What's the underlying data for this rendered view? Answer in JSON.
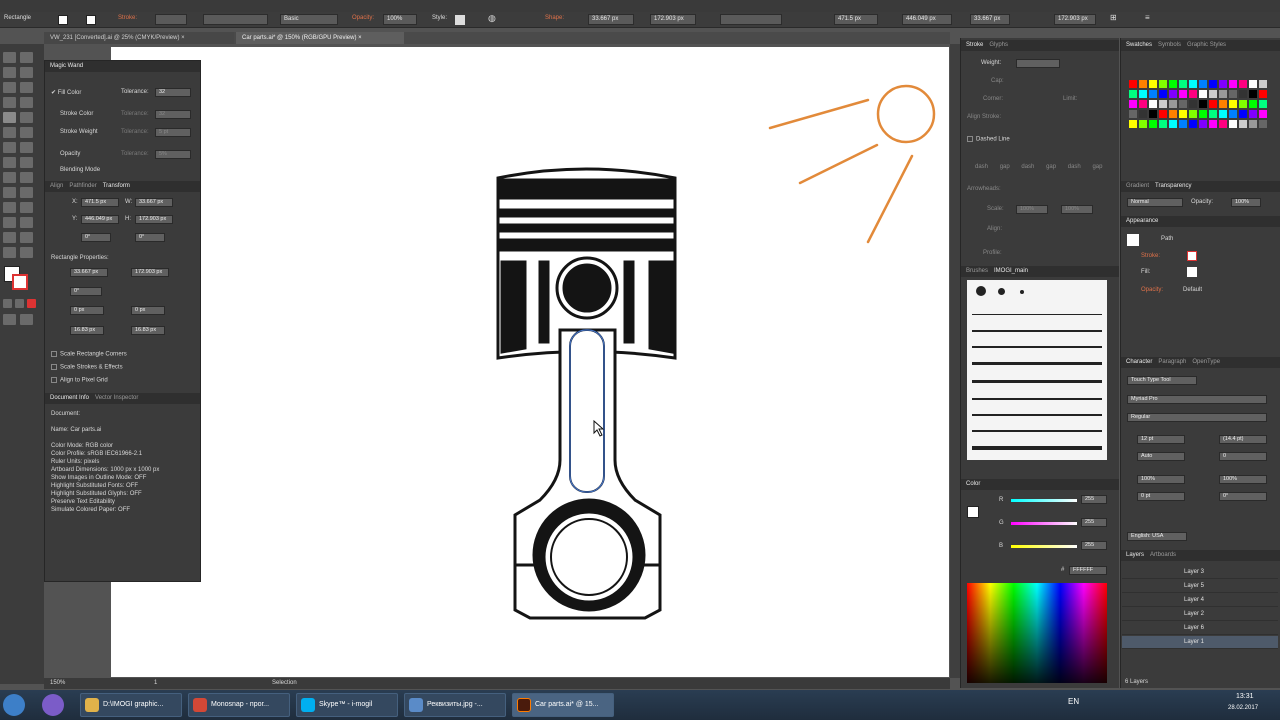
{
  "control_bar": {
    "tool_name": "Rectangle",
    "stroke_label": "Stroke:",
    "brush_style": "Basic",
    "opacity_label": "Opacity:",
    "opacity_value": "100%",
    "style_label": "Style:",
    "shape_label": "Shape:",
    "w_value": "33.667 px",
    "h_value": "172.903 px",
    "x_value": "471.5 px",
    "y_value": "446.049 px",
    "w2_value": "33.667 px",
    "h2_value": "172.903 px"
  },
  "tabs": [
    {
      "label": "VW_231 [Converted].ai @ 25% (CMYK/Preview)",
      "close": "×"
    },
    {
      "label": "Car parts.ai* @ 150% (RGB/GPU Preview)",
      "close": "×"
    }
  ],
  "magic_wand": {
    "title": "Magic Wand",
    "fill_color": "Fill Color",
    "tolerance_label": "Tolerance:",
    "tolerance_value": "32",
    "stroke_color": "Stroke Color",
    "stroke_weight": "Stroke Weight",
    "opacity": "Opacity",
    "blending_mode": "Blending Mode",
    "dim_tol_1": "32",
    "dim_tol_2": "5 pt",
    "dim_tol_3": "5%"
  },
  "transform": {
    "tabs": [
      "Align",
      "Pathfinder",
      "Transform"
    ],
    "x_label": "X:",
    "x": "471.5 px",
    "y_label": "Y:",
    "y": "446.049 px",
    "w_label": "W:",
    "w": "33.667 px",
    "h_label": "H:",
    "h": "172.903 px",
    "rot": "0°",
    "shear": "0°",
    "rect_props": "Rectangle Properties:",
    "rw": "33.667 px",
    "rh": "172.903 px",
    "angle": "0°",
    "r1": "0 px",
    "r2": "0 px",
    "r3": "16.83 px",
    "r4": "16.83 px",
    "scale_corners": "Scale Rectangle Corners",
    "scale_strokes": "Scale Strokes & Effects",
    "align_pixel": "Align to Pixel Grid"
  },
  "doc_info": {
    "tabs": [
      "Document Info",
      "Vector Inspector"
    ],
    "document": "Document:",
    "lines": [
      "Name: Car parts.ai",
      "Color Mode: RGB color",
      "Color Profile: sRGB IEC61966-2.1",
      "Ruler Units: pixels",
      "Artboard Dimensions: 1000 px x 1000 px",
      "Show Images in Outline Mode: OFF",
      "Highlight Substituted Fonts: OFF",
      "Highlight Substituted Glyphs: OFF",
      "Preserve Text Editability",
      "Simulate Colored Paper: OFF"
    ]
  },
  "stroke_panel": {
    "tabs": [
      "Stroke",
      "Glyphs"
    ],
    "weight_label": "Weight:",
    "cap_label": "Cap:",
    "corner_label": "Corner:",
    "limit_label": "Limit:",
    "align_label": "Align Stroke:",
    "dashed_line": "Dashed Line",
    "dash_labels": [
      "dash",
      "gap",
      "dash",
      "gap",
      "dash",
      "gap"
    ],
    "arrowheads": "Arrowheads:",
    "scale": "Scale:",
    "scale_value": "100%",
    "align": "Align:",
    "profile": "Profile:"
  },
  "brushes": {
    "tabs": [
      "Brushes",
      "IMOGI_main"
    ]
  },
  "color_panel": {
    "title": "Color",
    "r": "R",
    "g": "G",
    "b": "B",
    "r_val": "255",
    "g_val": "255",
    "b_val": "255",
    "hex_label": "#",
    "hex": "FFFFFF"
  },
  "swatches": {
    "tabs": [
      "Swatches",
      "Symbols",
      "Graphic Styles"
    ]
  },
  "gradient": {
    "tabs": [
      "Gradient",
      "Transparency"
    ],
    "mode": "Normal",
    "opacity_label": "Opacity:",
    "opacity": "100%"
  },
  "appearance": {
    "title": "Appearance",
    "path": "Path",
    "stroke": "Stroke:",
    "fill": "Fill:",
    "opacity": "Opacity:",
    "opacity_value": "Default"
  },
  "character": {
    "tabs": [
      "Character",
      "Paragraph",
      "OpenType"
    ],
    "touch_tool": "Touch Type Tool",
    "font": "Myriad Pro",
    "style": "Regular",
    "size": "12 pt",
    "leading": "(14.4 pt)",
    "kerning": "Auto",
    "tracking": "0",
    "hscale": "100%",
    "vscale": "100%",
    "baseline": "0 pt",
    "rotation": "0°",
    "language": "English: USA"
  },
  "layers": {
    "tabs": [
      "Layers",
      "Artboards"
    ],
    "items": [
      "Layer 3",
      "Layer 5",
      "Layer 4",
      "Layer 2",
      "Layer 6",
      "Layer 1"
    ],
    "count": "6 Layers"
  },
  "status": {
    "zoom": "150%",
    "page": "1",
    "tool": "Selection"
  },
  "taskbar": {
    "items": [
      "D:\\IMOGI graphic...",
      "Monosnap - прог...",
      "Skype™ - i-mogil",
      "Реквизиты.jpg -...",
      "Car parts.ai* @ 15..."
    ],
    "lang": "EN",
    "time": "13:31",
    "date": "28.02.2017"
  },
  "colors": {
    "accent_orange": "#e28a3a",
    "art_dark": "#141414",
    "selection_blue": "#4a7bd0"
  }
}
